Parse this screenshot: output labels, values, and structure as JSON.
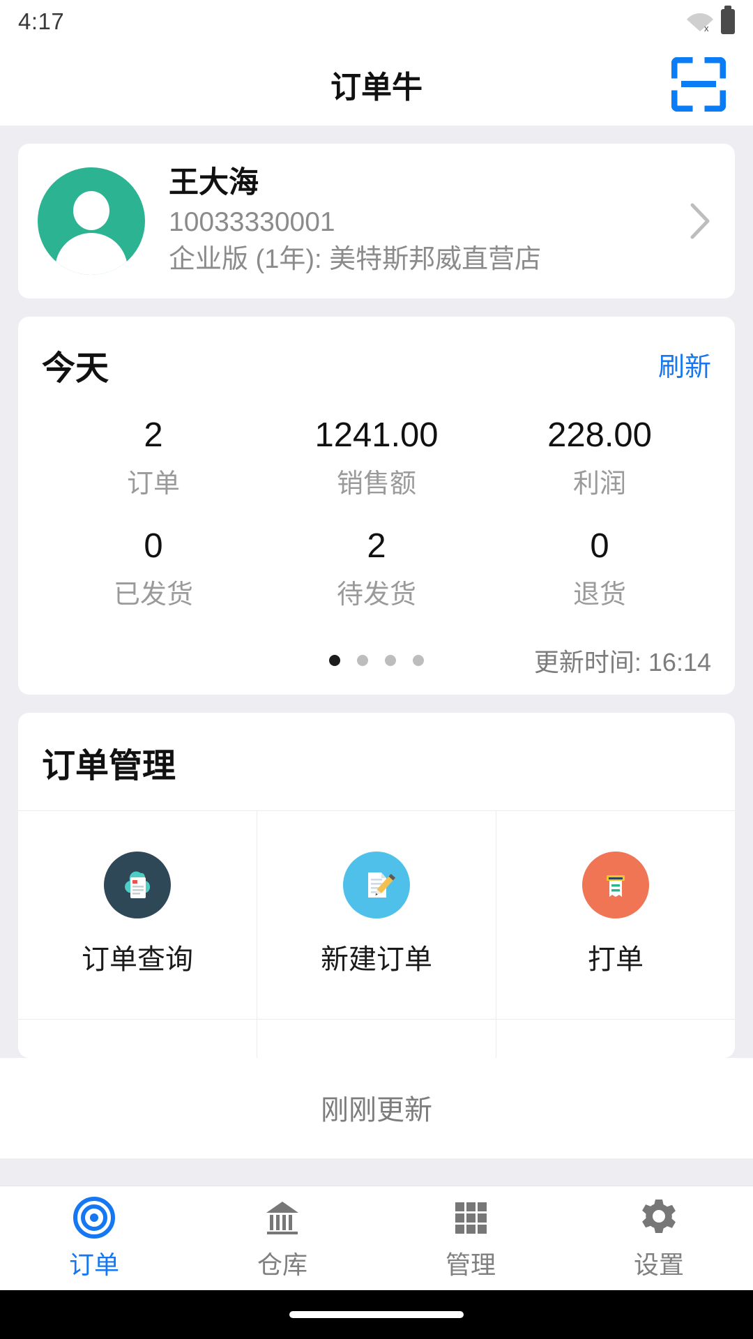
{
  "status_bar": {
    "time": "4:17",
    "wifi_icon": "wifi-off-icon",
    "battery_icon": "battery-full-icon"
  },
  "header": {
    "title": "订单牛",
    "scan_icon": "scan-qr-icon"
  },
  "profile": {
    "avatar_icon": "user-avatar-icon",
    "avatar_color": "#2bb392",
    "name": "王大海",
    "account_id": "10033330001",
    "plan": "企业版 (1年): 美特斯邦威直营店",
    "chevron_icon": "chevron-right-icon"
  },
  "stats": {
    "title": "今天",
    "refresh_label": "刷新",
    "refresh_color": "#1577f2",
    "cells": [
      {
        "value": "2",
        "label": "订单"
      },
      {
        "value": "1241.00",
        "label": "销售额"
      },
      {
        "value": "228.00",
        "label": "利润"
      },
      {
        "value": "0",
        "label": "已发货"
      },
      {
        "value": "2",
        "label": "待发货"
      },
      {
        "value": "0",
        "label": "退货"
      }
    ],
    "page_count": 4,
    "active_page": 1,
    "updated_text": "更新时间: 16:14"
  },
  "order_management": {
    "title": "订单管理",
    "items": [
      {
        "label": "订单查询",
        "icon": "document-search-icon",
        "circle_color": "#2f4858",
        "accent": "#4ecdc4"
      },
      {
        "label": "新建订单",
        "icon": "document-edit-icon",
        "circle_color": "#4fc0ea",
        "accent": "#f4bf4f"
      },
      {
        "label": "打单",
        "icon": "printer-receipt-icon",
        "circle_color": "#ef7555",
        "accent": "#f4c430"
      }
    ]
  },
  "footer": {
    "note": "刚刚更新"
  },
  "tabbar": {
    "items": [
      {
        "label": "订单",
        "icon": "target-icon",
        "active": true
      },
      {
        "label": "仓库",
        "icon": "bank-icon",
        "active": false
      },
      {
        "label": "管理",
        "icon": "grid-icon",
        "active": false
      },
      {
        "label": "设置",
        "icon": "gear-icon",
        "active": false
      }
    ],
    "active_color": "#1577f2",
    "inactive_color": "#808080"
  },
  "system_nav": {
    "home_indicator": "home-pill-indicator"
  }
}
